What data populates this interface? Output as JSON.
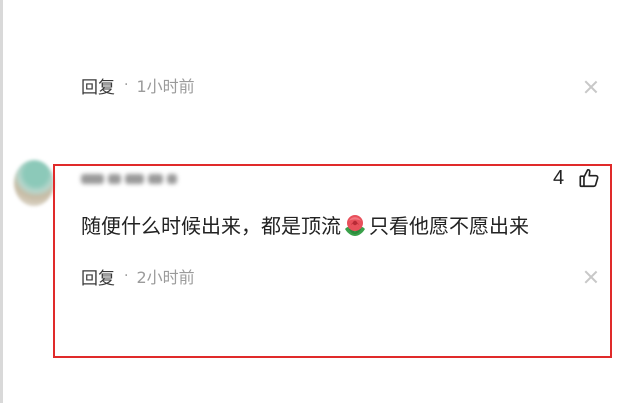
{
  "comment_previous": {
    "reply_label": "回复",
    "separator": "·",
    "time": "1小时前"
  },
  "comment_highlighted": {
    "username": "",
    "likes": "4",
    "text_before_emoji": "随便什么时候出来，都是顶流",
    "emoji": "rose-emoji",
    "text_after_emoji": "只看他愿不愿出来",
    "reply_label": "回复",
    "separator": "·",
    "time": "2小时前"
  },
  "colors": {
    "highlight_border": "#e02a2a",
    "muted_text": "#9b9b9b",
    "main_text": "#222222"
  }
}
